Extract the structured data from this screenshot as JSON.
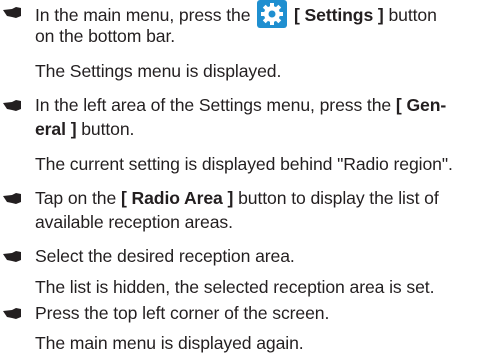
{
  "steps": [
    {
      "icon": "pointing-hand-icon",
      "line1_a": "In the main menu, press the",
      "line1_icon": "settings-gear-icon",
      "line1_b": "[ Settings ]",
      "line1_c": " button",
      "line2": "on the bottom bar.",
      "result": "The Settings menu is displayed."
    },
    {
      "icon": "pointing-hand-icon",
      "line1_a": "In the left area of the Settings menu, press the",
      "line1_b": "[ Gen-",
      "line2_b": "eral ]",
      "line2_c": " button.",
      "result": "The current setting is displayed behind \"Radio region\"."
    },
    {
      "icon": "pointing-hand-icon",
      "line1_a": "Tap on the",
      "line1_b": "[ Radio Area ]",
      "line1_c": " button to display the list of",
      "line2": "available reception areas."
    },
    {
      "icon": "pointing-hand-icon",
      "line1": "Select the desired reception area.",
      "result": "The list is hidden, the selected reception area is set."
    },
    {
      "icon": "pointing-hand-icon",
      "line1": "Press the top left corner of the screen.",
      "result": "The main menu is displayed again."
    }
  ],
  "colors": {
    "text": "#231f20",
    "gear_blue": "#1f8fd0",
    "gear_white": "#ffffff"
  }
}
